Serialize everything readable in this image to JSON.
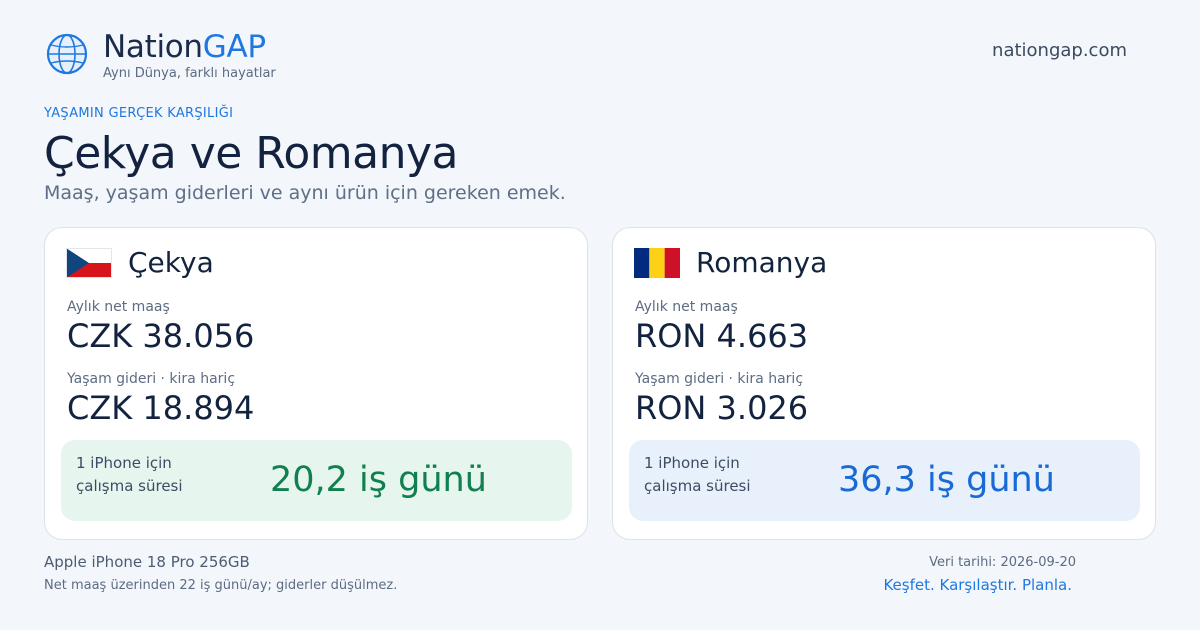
{
  "header": {
    "brand_part1": "Nation",
    "brand_part2": "GAP",
    "tagline": "Aynı Dünya, farklı hayatlar",
    "site_url": "nationgap.com",
    "logo_icon": "globe-icon"
  },
  "hero": {
    "eyebrow": "YAŞAMIN GERÇEK KARŞILIĞI",
    "title": "Çekya ve Romanya",
    "subtitle": "Maaş, yaşam giderleri ve aynı ürün için gereken emek."
  },
  "countries": [
    {
      "name": "Çekya",
      "flag_icon": "czech-flag-icon",
      "salary_label": "Aylık net maaş",
      "salary_value": "CZK 38.056",
      "cost_label": "Yaşam gideri · kira hariç",
      "cost_value": "CZK 18.894",
      "work_label_line1": "1 iPhone için",
      "work_label_line2": "çalışma süresi",
      "work_value": "20,2 iş günü"
    },
    {
      "name": "Romanya",
      "flag_icon": "romania-flag-icon",
      "salary_label": "Aylık net maaş",
      "salary_value": "RON 4.663",
      "cost_label": "Yaşam gideri · kira hariç",
      "cost_value": "RON 3.026",
      "work_label_line1": "1 iPhone için",
      "work_label_line2": "çalışma süresi",
      "work_value": "36,3 iş günü"
    }
  ],
  "footer": {
    "product": "Apple iPhone 18 Pro 256GB",
    "note": "Net maaş üzerinden 22 iş günü/ay; giderler düşülmez.",
    "data_date": "Veri tarihi: 2026-09-20",
    "cta": "Keşfet. Karşılaştır. Planla."
  },
  "colors": {
    "accent": "#1f78e0",
    "background": "#f3f6fb",
    "czech_highlight": "#11804f",
    "romania_highlight": "#1a6ad6"
  }
}
